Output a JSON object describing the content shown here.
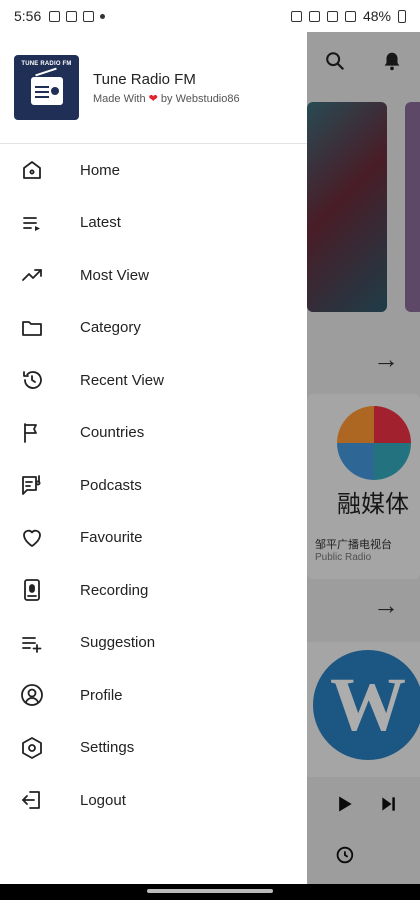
{
  "status_bar": {
    "time": "5:56",
    "battery": "48%"
  },
  "drawer": {
    "app_title": "Tune Radio FM",
    "subtitle_pre": "Made With",
    "subtitle_post": "by Webstudio86",
    "logo_text": "TUNE RADIO FM",
    "items": [
      {
        "label": "Home",
        "icon": "home-icon"
      },
      {
        "label": "Latest",
        "icon": "playlist-icon"
      },
      {
        "label": "Most View",
        "icon": "trending-icon"
      },
      {
        "label": "Category",
        "icon": "folder-icon"
      },
      {
        "label": "Recent View",
        "icon": "history-icon"
      },
      {
        "label": "Countries",
        "icon": "flag-icon"
      },
      {
        "label": "Podcasts",
        "icon": "podcast-icon"
      },
      {
        "label": "Favourite",
        "icon": "heart-icon"
      },
      {
        "label": "Recording",
        "icon": "recording-icon"
      },
      {
        "label": "Suggestion",
        "icon": "playlist-add-icon"
      },
      {
        "label": "Profile",
        "icon": "profile-icon"
      },
      {
        "label": "Settings",
        "icon": "settings-icon"
      },
      {
        "label": "Logout",
        "icon": "logout-icon"
      }
    ]
  },
  "background": {
    "station_cn": "融媒体",
    "station_name": "邹平广播电视台",
    "station_genre": "Public Radio"
  },
  "colors": {
    "logo_bg": "#1f2f55",
    "heart": "#e0242f"
  }
}
